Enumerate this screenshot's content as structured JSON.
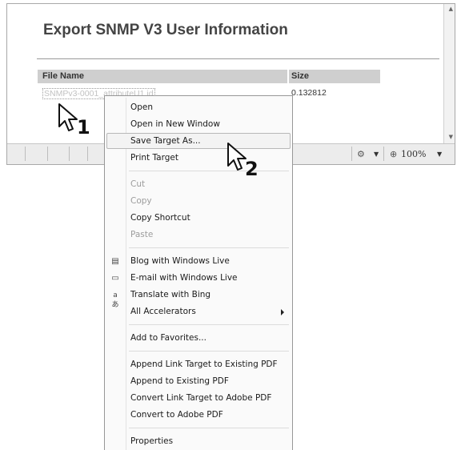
{
  "page": {
    "title": "Export SNMP V3 User Information",
    "table": {
      "headers": [
        "File Name",
        "Size"
      ],
      "rows": [
        {
          "file": "SNMPv3-0001_attributeU1.id",
          "size": "0.132812"
        }
      ]
    }
  },
  "statusbar": {
    "zone_icon": "protected-mode-icon",
    "zoom_label": "100%"
  },
  "context_menu": {
    "items": [
      {
        "label": "Open",
        "enabled": true
      },
      {
        "label": "Open in New Window",
        "enabled": true
      },
      {
        "label": "Save Target As...",
        "enabled": true,
        "highlighted": true
      },
      {
        "label": "Print Target",
        "enabled": true
      },
      {
        "label": "Cut",
        "enabled": false
      },
      {
        "label": "Copy",
        "enabled": false
      },
      {
        "label": "Copy Shortcut",
        "enabled": true
      },
      {
        "label": "Paste",
        "enabled": false
      },
      {
        "label": "Blog with Windows Live",
        "enabled": true,
        "icon": "blog-icon"
      },
      {
        "label": "E-mail with Windows Live",
        "enabled": true,
        "icon": "email-icon"
      },
      {
        "label": "Translate with Bing",
        "enabled": true,
        "icon": "translate-icon"
      },
      {
        "label": "All Accelerators",
        "enabled": true,
        "submenu": true
      },
      {
        "label": "Add to Favorites...",
        "enabled": true
      },
      {
        "label": "Append Link Target to Existing PDF",
        "enabled": true
      },
      {
        "label": "Append to Existing PDF",
        "enabled": true
      },
      {
        "label": "Convert Link Target to Adobe PDF",
        "enabled": true
      },
      {
        "label": "Convert to Adobe PDF",
        "enabled": true
      },
      {
        "label": "Properties",
        "enabled": true
      }
    ]
  },
  "callouts": {
    "step1": "1",
    "step2": "2"
  }
}
